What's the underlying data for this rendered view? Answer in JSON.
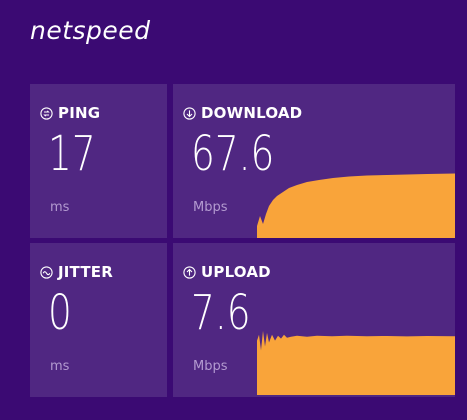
{
  "brand": {
    "name": "netspeed"
  },
  "colors": {
    "background": "#3b0a73",
    "card": "#502782",
    "graph_fill": "#f9a43a",
    "unit_text": "#b39ad0"
  },
  "ping": {
    "icon": "ping-icon",
    "title": "PING",
    "value": "17",
    "unit": "ms"
  },
  "jitter": {
    "icon": "jitter-icon",
    "title": "JITTER",
    "value": "0",
    "unit": "ms"
  },
  "download": {
    "icon": "download-arrow-icon",
    "title": "DOWNLOAD",
    "value": "67.6",
    "unit": "Mbps"
  },
  "upload": {
    "icon": "upload-arrow-icon",
    "title": "UPLOAD",
    "value": "7.6",
    "unit": "Mbps"
  }
}
